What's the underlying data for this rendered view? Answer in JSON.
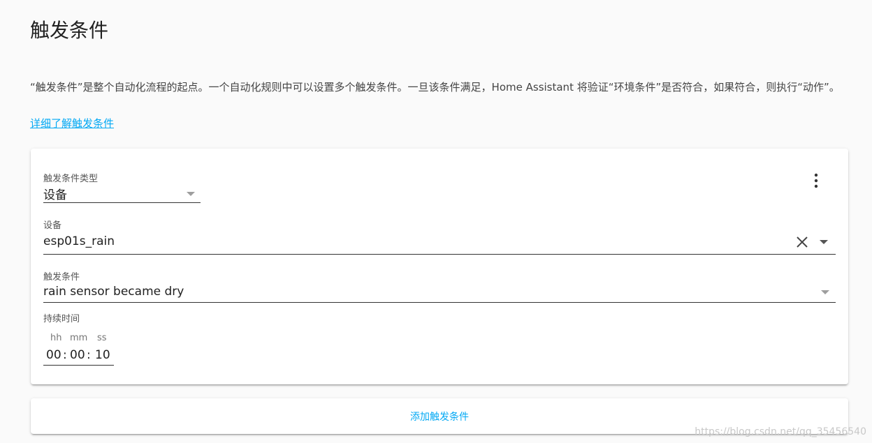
{
  "page": {
    "title": "触发条件",
    "intro": "“触发条件”是整个自动化流程的起点。一个自动化规则中可以设置多个触发条件。一旦该条件满足，Home Assistant 将验证“环境条件”是否符合，如果符合，则执行“动作”。",
    "learn_more": "详细了解触发条件"
  },
  "trigger": {
    "type_label": "触发条件类型",
    "type_value": "设备",
    "device_label": "设备",
    "device_value": "esp01s_rain",
    "condition_label": "触发条件",
    "condition_value": "rain sensor became dry",
    "duration_label": "持续时间",
    "duration": {
      "hh_label": "hh",
      "mm_label": "mm",
      "ss_label": "ss",
      "hh": "00",
      "mm": "00",
      "ss": "10",
      "sep": ":"
    },
    "menu_icon": "more-vertical-icon",
    "clear_icon": "close-icon",
    "dropdown_icon": "caret-down-icon"
  },
  "add_trigger": {
    "label": "添加触发条件"
  },
  "watermark": "https://blog.csdn.net/qq_35456540",
  "colors": {
    "accent": "#03a9f4",
    "background": "#fafafa",
    "card": "#ffffff"
  }
}
